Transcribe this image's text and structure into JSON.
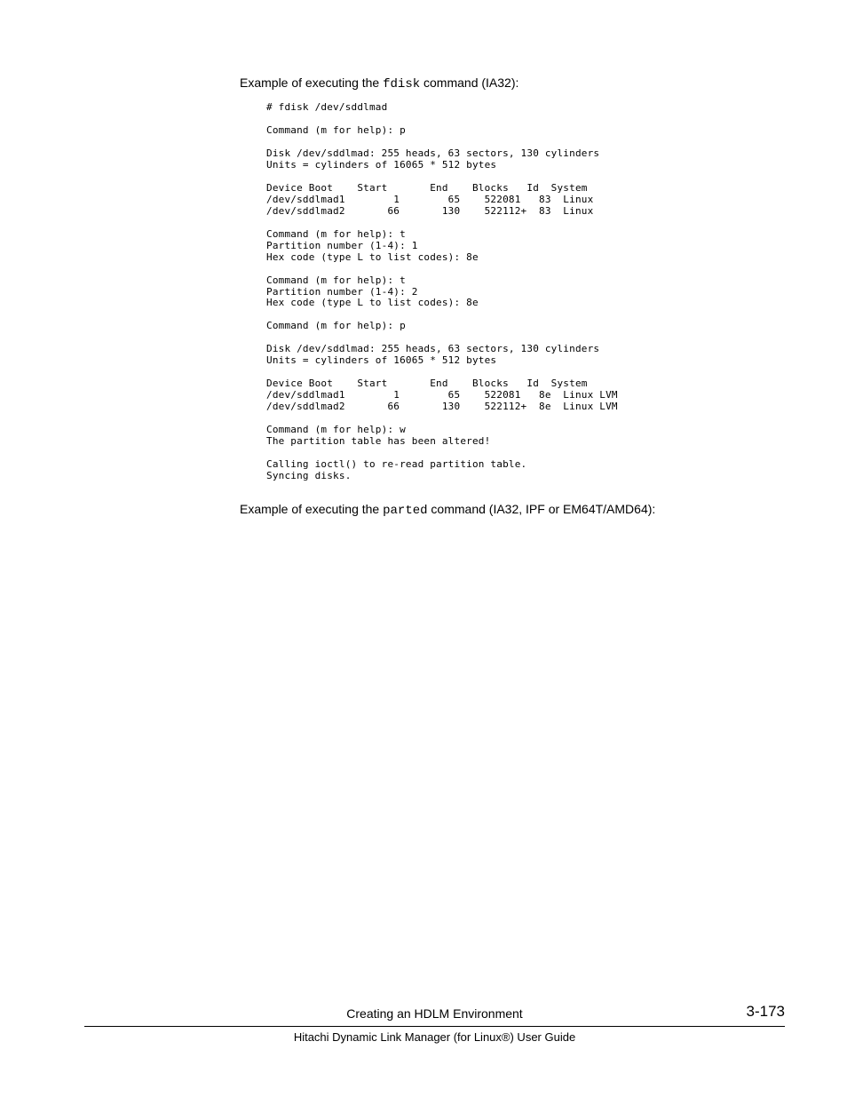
{
  "intro1_pre": "Example of executing the ",
  "intro1_cmd": "fdisk",
  "intro1_post": " command (IA32):",
  "terminal1": "# fdisk /dev/sddlmad\n\nCommand (m for help): p\n\nDisk /dev/sddlmad: 255 heads, 63 sectors, 130 cylinders\nUnits = cylinders of 16065 * 512 bytes\n\nDevice Boot    Start       End    Blocks   Id  System\n/dev/sddlmad1        1        65    522081   83  Linux\n/dev/sddlmad2       66       130    522112+  83  Linux\n\nCommand (m for help): t\nPartition number (1-4): 1\nHex code (type L to list codes): 8e\n\nCommand (m for help): t\nPartition number (1-4): 2\nHex code (type L to list codes): 8e\n\nCommand (m for help): p\n\nDisk /dev/sddlmad: 255 heads, 63 sectors, 130 cylinders\nUnits = cylinders of 16065 * 512 bytes\n\nDevice Boot    Start       End    Blocks   Id  System\n/dev/sddlmad1        1        65    522081   8e  Linux LVM\n/dev/sddlmad2       66       130    522112+  8e  Linux LVM\n\nCommand (m for help): w\nThe partition table has been altered!\n\nCalling ioctl() to re-read partition table.\nSyncing disks.",
  "intro2_pre": "Example of executing the ",
  "intro2_cmd": "parted",
  "intro2_post": " command (IA32, IPF or EM64T/AMD64):",
  "footer_title": "Creating an HDLM Environment",
  "page_number": "3-173",
  "footer_sub": "Hitachi Dynamic Link Manager (for Linux®) User Guide"
}
